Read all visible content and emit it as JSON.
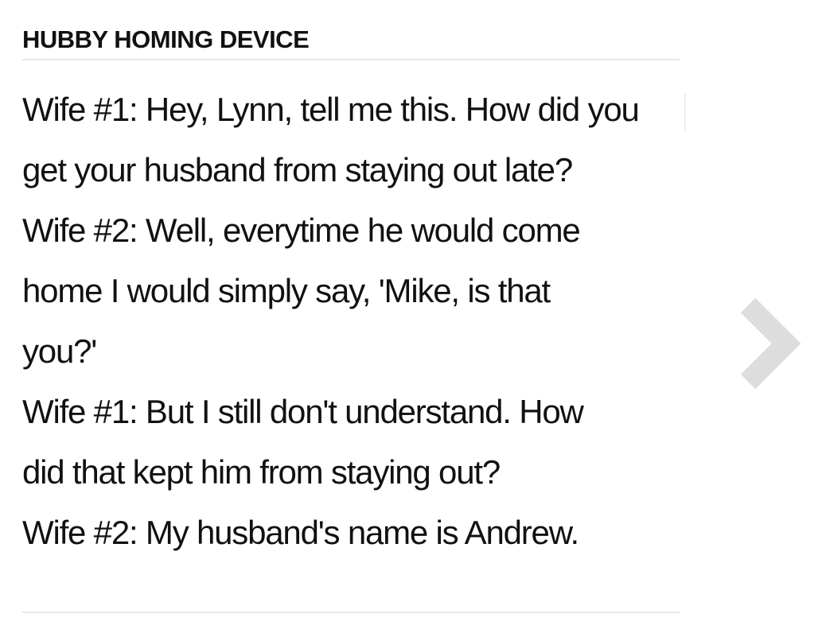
{
  "article": {
    "title": "HUBBY HOMING DEVICE",
    "lines": [
      "Wife #1: Hey, Lynn, tell me this. How did you",
      "get your husband from staying out late?",
      "Wife #2: Well, everytime he would come",
      "home I would simply say, 'Mike, is that",
      "you?'",
      "Wife #1: But I still don't understand. How",
      "did that kept him from staying out?",
      "Wife #2: My husband's name is Andrew."
    ]
  },
  "navigation": {
    "next_icon": "chevron-right-icon"
  },
  "colors": {
    "text": "#111111",
    "divider": "#e6e6e6",
    "chevron": "#dddddd",
    "background": "#ffffff"
  }
}
